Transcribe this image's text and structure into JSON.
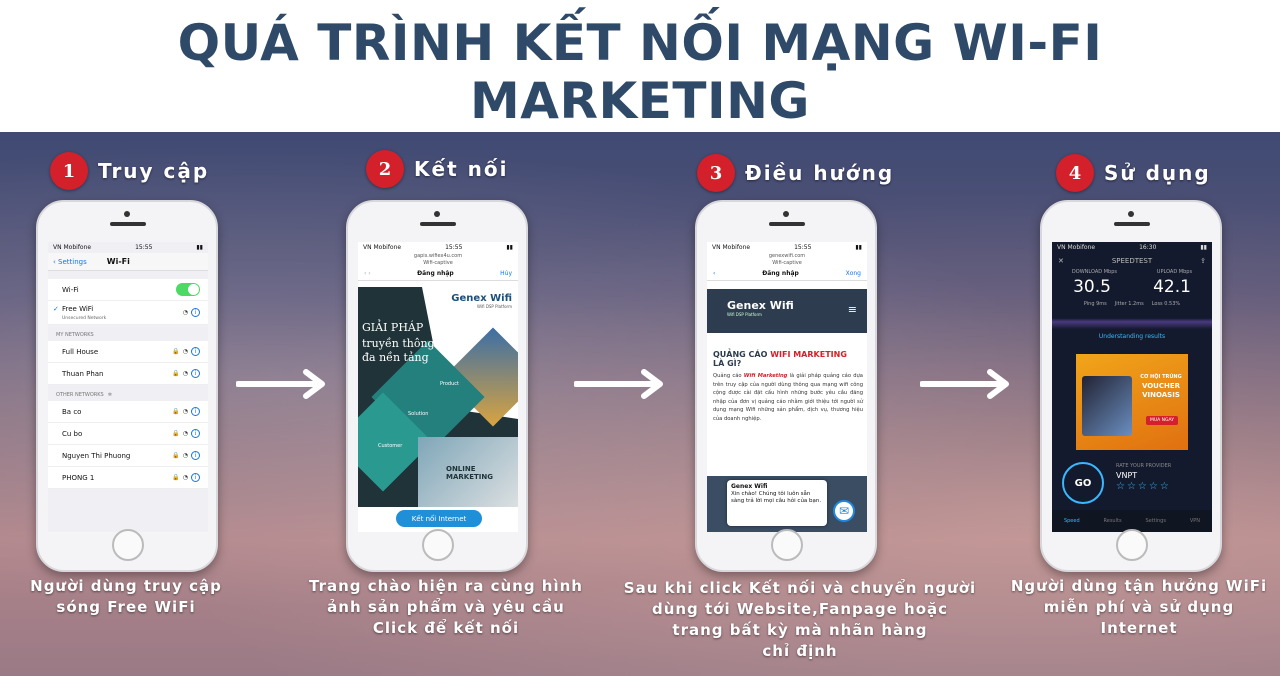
{
  "title": "QUÁ TRÌNH KẾT NỐI MẠNG WI-FI MARKETING",
  "colors": {
    "title": "#2f4a68",
    "badge": "#d3202a",
    "accent": "#1a73e8"
  },
  "steps": [
    {
      "number": "1",
      "title": "Truy cập",
      "caption": [
        "Người dùng truy cập",
        "sóng Free WiFi"
      ]
    },
    {
      "number": "2",
      "title": "Kết nối",
      "caption": [
        "Trang chào hiện ra cùng hình",
        "ảnh sản phẩm và yêu cầu",
        "Click để kết nối"
      ]
    },
    {
      "number": "3",
      "title": "Điều hướng",
      "caption": [
        "Sau khi click Kết nối và chuyển người",
        "dùng tới Website,Fanpage hoặc",
        "trang bất kỳ mà nhãn hàng",
        "chỉ định"
      ]
    },
    {
      "number": "4",
      "title": "Sử dụng",
      "caption": [
        "Người dùng tận hưởng WiFi",
        "miễn phí và sử dụng",
        "Internet"
      ]
    }
  ],
  "phone1": {
    "carrier": "VN Mobifone",
    "time": "15:55",
    "back": "Settings",
    "nav_title": "Wi-Fi",
    "wifi_label": "Wi-Fi",
    "connected": "Free WiFi",
    "connected_sub": "Unsecured Network",
    "my_networks": "MY NETWORKS",
    "other_networks": "OTHER NETWORKS",
    "my": [
      "Full House",
      "Thuan Phan"
    ],
    "other": [
      "Ba co",
      "Cu bo",
      "Nguyen Thi Phuong",
      "PHONG 1"
    ]
  },
  "phone2": {
    "carrier": "VN Mobifone",
    "time": "15:55",
    "url": "gapis.wifiex4u.com",
    "url_sub": "Wifi-captive",
    "nav_title": "Đăng nhập",
    "cancel": "Hủy",
    "brand": "Genex Wifi",
    "brand_sub": "Wifi DSP Platform",
    "headline1": "GIẢI PHÁP",
    "headline2": "truyền thông",
    "headline3": "đa nền tảng",
    "label_product": "Product",
    "label_solution": "Solution",
    "label_customer": "Customer",
    "online": "ONLINE MARKETING",
    "button": "Kết nối Internet"
  },
  "phone3": {
    "carrier": "VN Mobifone",
    "time": "15:55",
    "url": "genexwifi.com",
    "url_sub": "Wifi-captive",
    "nav_title": "Đăng nhập",
    "done": "Xong",
    "brand": "Genex Wifi",
    "brand_sub": "Wifi DSP Platform",
    "h_part1": "QUẢNG CÁO ",
    "h_red": "WIFI MARKETING",
    "h_part2": "LÀ GÌ?",
    "body_lead": "Quảng cáo ",
    "body_red": "Wifi Marketing",
    "body": " là giải pháp quảng cáo dựa trên truy cập của người dùng thông qua mạng wifi công cộng được cài đặt cấu hình những bước yêu cầu đăng nhập của đơn vị quảng cáo nhằm giới thiệu tới người sử dụng mạng Wifi những sản phẩm, dịch vụ, thương hiệu của doanh nghiệp.",
    "chat_title": "Genex Wifi",
    "chat_msg": "Xin chào! Chúng tôi luôn sẵn sàng trả lời mọi câu hỏi của bạn."
  },
  "phone4": {
    "carrier": "VN Mobifone",
    "time": "16:30",
    "app": "SPEEDTEST",
    "download_label": "DOWNLOAD",
    "upload_label": "UPLOAD",
    "unit": "Mbps",
    "download": "30.5",
    "upload": "42.1",
    "ping": "Ping 9ms",
    "jitter": "Jitter 1.2ms",
    "loss": "Loss 0.53%",
    "understanding": "Understanding results",
    "ad_line1": "CƠ HỘI TRÚNG",
    "ad_line2": "VOUCHER",
    "ad_line3": "VINOASIS",
    "ad_btn": "MUA NGAY",
    "go": "GO",
    "rate": "RATE YOUR PROVIDER",
    "provider": "VNPT",
    "stars": "☆☆☆☆☆",
    "tabs": [
      "Speed",
      "Results",
      "Settings",
      "VPN"
    ]
  }
}
